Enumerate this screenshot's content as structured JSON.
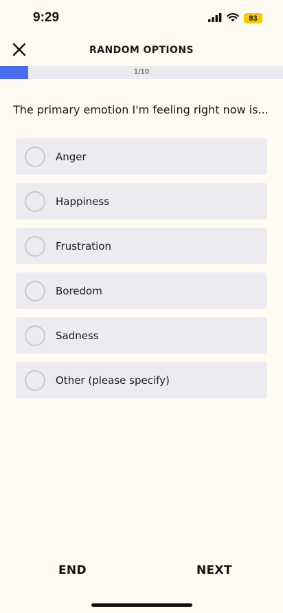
{
  "status_bar": {
    "time": "9:29",
    "battery_level": "83",
    "battery_color": "#f5c800"
  },
  "header": {
    "title": "RANDOM OPTIONS",
    "close_icon": "close-icon"
  },
  "progress": {
    "label": "1/10",
    "fraction": 0.1,
    "fill_color": "#4a6cf0"
  },
  "question": {
    "text": "The primary emotion I'm feeling right now is..."
  },
  "options": [
    {
      "label": "Anger"
    },
    {
      "label": "Happiness"
    },
    {
      "label": "Frustration"
    },
    {
      "label": "Boredom"
    },
    {
      "label": "Sadness"
    },
    {
      "label": "Other (please specify)"
    }
  ],
  "footer": {
    "end_label": "END",
    "next_label": "NEXT"
  }
}
